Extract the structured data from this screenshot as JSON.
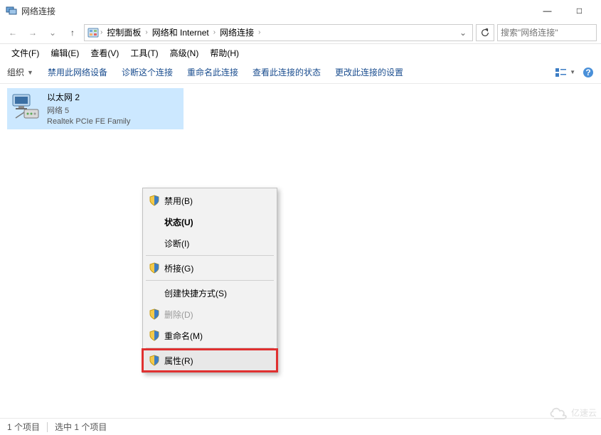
{
  "window": {
    "title": "网络连接",
    "controls": {
      "min": "—",
      "max": "□"
    }
  },
  "nav": {
    "back": "←",
    "forward": "→",
    "up": "↑",
    "refresh": "⟳",
    "dropdown": "⌄"
  },
  "breadcrumb": {
    "items": [
      "控制面板",
      "网络和 Internet",
      "网络连接"
    ],
    "sep": "›"
  },
  "search": {
    "placeholder": "搜索\"网络连接\""
  },
  "menubar": [
    "文件(F)",
    "编辑(E)",
    "查看(V)",
    "工具(T)",
    "高级(N)",
    "帮助(H)"
  ],
  "toolbar": {
    "organize": "组织",
    "items": [
      "禁用此网络设备",
      "诊断这个连接",
      "重命名此连接",
      "查看此连接的状态",
      "更改此连接的设置"
    ]
  },
  "adapter": {
    "name": "以太网 2",
    "network": "网络  5",
    "device": "Realtek PCIe FE Family"
  },
  "contextMenu": {
    "items": [
      {
        "label": "禁用(B)",
        "shield": true,
        "disabled": false,
        "bold": false
      },
      {
        "label": "状态(U)",
        "shield": false,
        "disabled": false,
        "bold": true
      },
      {
        "label": "诊断(I)",
        "shield": false,
        "disabled": false,
        "bold": false
      },
      {
        "sep": true
      },
      {
        "label": "桥接(G)",
        "shield": true,
        "disabled": false,
        "bold": false
      },
      {
        "sep": true
      },
      {
        "label": "创建快捷方式(S)",
        "shield": false,
        "disabled": false,
        "bold": false
      },
      {
        "label": "删除(D)",
        "shield": true,
        "disabled": true,
        "bold": false
      },
      {
        "label": "重命名(M)",
        "shield": true,
        "disabled": false,
        "bold": false
      },
      {
        "sep": true
      },
      {
        "label": "属性(R)",
        "shield": true,
        "disabled": false,
        "bold": false,
        "highlight": true
      }
    ]
  },
  "statusbar": {
    "count": "1 个项目",
    "selected": "选中 1 个项目"
  },
  "watermark": "亿速云"
}
